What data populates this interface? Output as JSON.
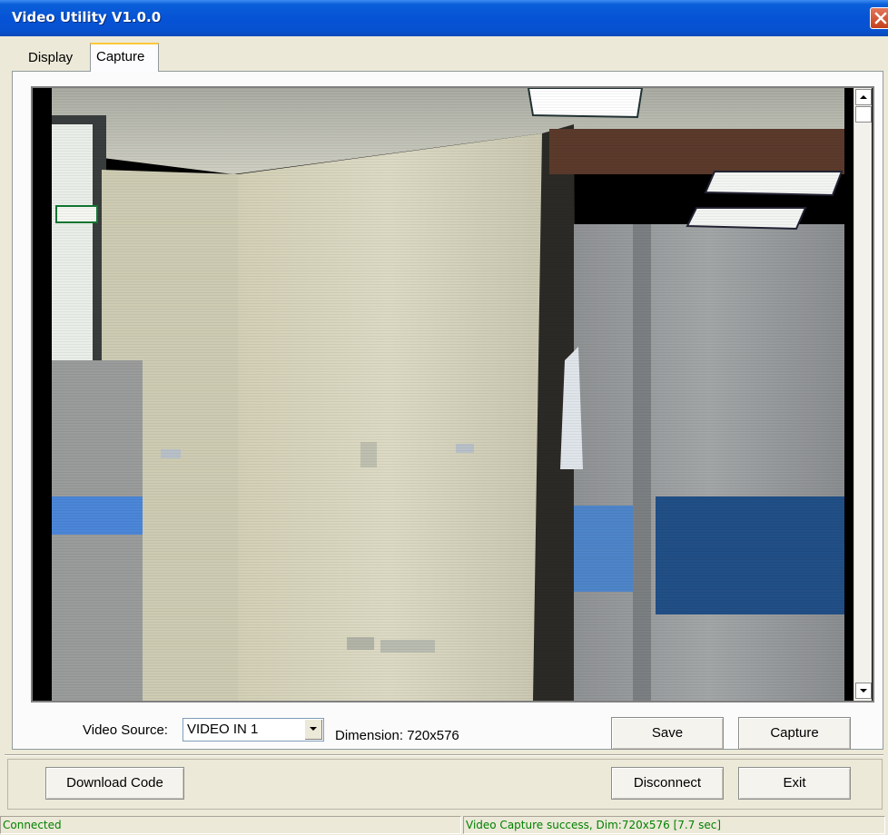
{
  "window": {
    "title": "Video Utility V1.0.0"
  },
  "tabs": [
    {
      "label": "Display",
      "active": false
    },
    {
      "label": "Capture",
      "active": true
    }
  ],
  "capture": {
    "video_source_label": "Video Source:",
    "video_source_value": "VIDEO IN 1",
    "dimension_label": "Dimension: 720x576",
    "save_label": "Save",
    "capture_label": "Capture"
  },
  "footer": {
    "download_label": "Download Code",
    "disconnect_label": "Disconnect",
    "exit_label": "Exit"
  },
  "status": {
    "left": "Connected",
    "right": "Video Capture success, Dim:720x576 [7.7 sec]",
    "color": "#008000"
  },
  "colors": {
    "titlebar": "#0653d6",
    "window_bg": "#ece9d8",
    "tab_accent": "#ffc83c",
    "close_button": "#c4401c"
  },
  "icons": {
    "close": "close-icon",
    "dropdown": "chevron-down-icon",
    "scroll_up": "arrow-up-icon",
    "scroll_down": "arrow-down-icon"
  }
}
